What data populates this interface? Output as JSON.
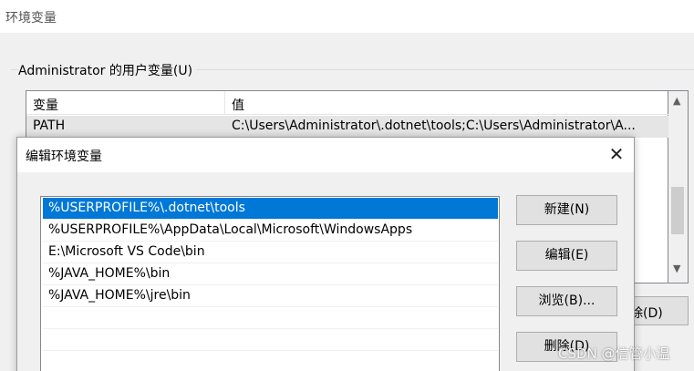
{
  "background_window": {
    "title": "环境变量",
    "user_vars_group_label": "Administrator 的用户变量(U)",
    "table": {
      "col_variable": "变量",
      "col_value": "值",
      "rows": [
        {
          "variable": "PATH",
          "value": "C:\\Users\\Administrator\\.dotnet\\tools;C:\\Users\\Administrator\\A..."
        }
      ]
    },
    "partial_button_label": "除(D)"
  },
  "dialog": {
    "title": "编辑环境变量",
    "close_glyph": "✕",
    "path_entries": [
      "%USERPROFILE%\\.dotnet\\tools",
      "%USERPROFILE%\\AppData\\Local\\Microsoft\\WindowsApps",
      "E:\\Microsoft VS Code\\bin",
      "%JAVA_HOME%\\bin",
      "%JAVA_HOME%\\jre\\bin",
      "",
      "",
      ""
    ],
    "selected_index": 0,
    "buttons": {
      "new": "新建(N)",
      "edit": "编辑(E)",
      "browse": "浏览(B)...",
      "delete": "删除(D)"
    }
  },
  "watermark": "CSDN @信管小温",
  "colors": {
    "selection": "#0078d7",
    "window_bg": "#f0f0f0",
    "button_bg": "#e1e1e1"
  }
}
